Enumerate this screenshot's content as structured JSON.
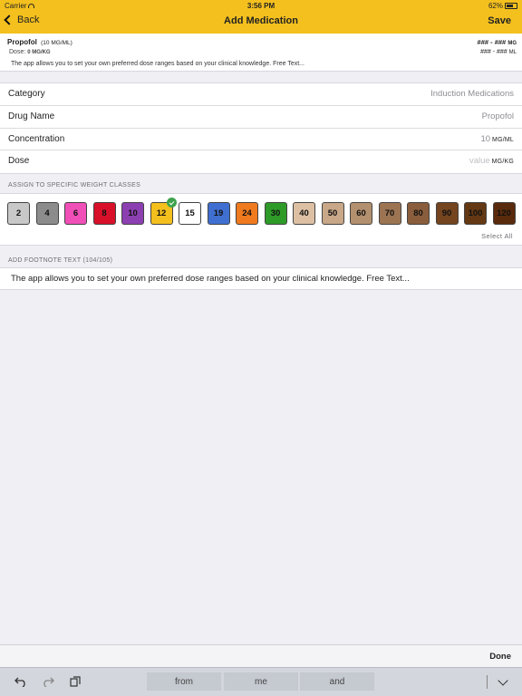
{
  "status_bar": {
    "carrier": "Carrier",
    "time": "3:56 PM",
    "battery": "62%"
  },
  "nav": {
    "back_label": "Back",
    "title": "Add Medication",
    "save_label": "Save"
  },
  "summary": {
    "drug": "Propofol",
    "concentration": "(10 MG/ML)",
    "dose_label": "Dose:",
    "dose_value": "0 MG/KG",
    "note": "The app allows you to set your own preferred dose ranges based on your clinical knowledge.  Free Text...",
    "range_mg_value": "### - ###",
    "range_mg_unit": "MG",
    "range_ml_value": "### - ###",
    "range_ml_unit": "ML"
  },
  "form": {
    "category": {
      "label": "Category",
      "value": "Induction Medications"
    },
    "drug_name": {
      "label": "Drug Name",
      "value": "Propofol"
    },
    "concentration": {
      "label": "Concentration",
      "value": "10",
      "unit": "MG/ML"
    },
    "dose": {
      "label": "Dose",
      "placeholder": "value",
      "unit": "MG/KG"
    }
  },
  "weights": {
    "header": "ASSIGN TO SPECIFIC WEIGHT CLASSES",
    "select_all": "Select All",
    "classes": [
      {
        "label": "2",
        "bg": "#c8c8c8",
        "fg": "#111",
        "selected": false
      },
      {
        "label": "4",
        "bg": "#8c8c8c",
        "fg": "#111",
        "selected": false
      },
      {
        "label": "6",
        "bg": "#f04fb8",
        "fg": "#111",
        "selected": false
      },
      {
        "label": "8",
        "bg": "#d8102a",
        "fg": "#111",
        "selected": false
      },
      {
        "label": "10",
        "bg": "#8c3fb0",
        "fg": "#111",
        "selected": false
      },
      {
        "label": "12",
        "bg": "#f4c01e",
        "fg": "#111",
        "selected": true
      },
      {
        "label": "15",
        "bg": "#ffffff",
        "fg": "#111",
        "selected": false
      },
      {
        "label": "19",
        "bg": "#3f6fd0",
        "fg": "#111",
        "selected": false
      },
      {
        "label": "24",
        "bg": "#f07a1e",
        "fg": "#111",
        "selected": false
      },
      {
        "label": "30",
        "bg": "#2e9a28",
        "fg": "#111",
        "selected": false
      },
      {
        "label": "40",
        "bg": "#ddc0a4",
        "fg": "#111",
        "selected": false
      },
      {
        "label": "50",
        "bg": "#c8a888",
        "fg": "#111",
        "selected": false
      },
      {
        "label": "60",
        "bg": "#b3906e",
        "fg": "#111",
        "selected": false
      },
      {
        "label": "70",
        "bg": "#9c7452",
        "fg": "#111",
        "selected": false
      },
      {
        "label": "80",
        "bg": "#8a5e3c",
        "fg": "#111",
        "selected": false
      },
      {
        "label": "90",
        "bg": "#74451f",
        "fg": "#111",
        "selected": false
      },
      {
        "label": "100",
        "bg": "#643812",
        "fg": "#111",
        "selected": false
      },
      {
        "label": "120",
        "bg": "#5a2a0c",
        "fg": "#111",
        "selected": false
      }
    ]
  },
  "footnote": {
    "header": "ADD FOOTNOTE TEXT (104/105)",
    "text": "The app allows you to set your own preferred dose ranges based on your clinical knowledge.  Free Text..."
  },
  "keyboard": {
    "done_label": "Done",
    "suggestions": [
      "from",
      "me",
      "and"
    ]
  }
}
